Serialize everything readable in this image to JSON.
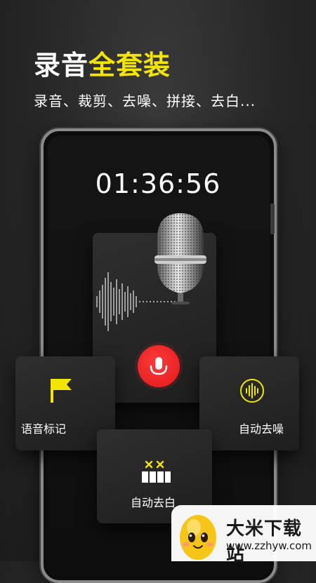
{
  "header": {
    "title_part1": "录音",
    "title_part2": "全套装",
    "subtitle": "录音、裁剪、去噪、拼接、去白..."
  },
  "recorder": {
    "timer": "01:36:56"
  },
  "features": {
    "voice_mark": "语音标记",
    "auto_denoise": "自动去噪",
    "auto_remove_silence": "自动去白"
  },
  "watermark": {
    "site_name": "大米下载站",
    "site_url": "www.zzhyw.com"
  },
  "colors": {
    "accent_yellow": "#f3e500",
    "record_red": "#e8201f",
    "background": "#262626"
  },
  "icons": {
    "flag": "flag-icon",
    "waveform": "waveform-icon",
    "trim": "trim-icon",
    "microphone": "microphone-icon",
    "record": "record-button"
  }
}
